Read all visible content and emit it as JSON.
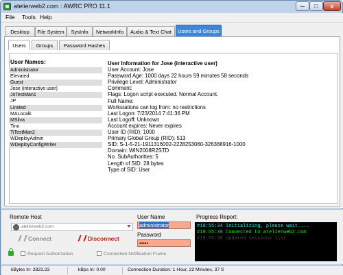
{
  "window": {
    "title": "atelierweb2.com : AWRC PRO 11.1",
    "min": "─",
    "max": "□",
    "close": "x"
  },
  "menu": [
    "File",
    "Tools",
    "Help"
  ],
  "main_tabs": [
    "Desktop",
    "File System",
    "SysInfo",
    "NetworkInfo",
    "Audio & Text Chat",
    "Users and Groups"
  ],
  "active_main_tab": "Users and Groups",
  "sub_tabs": [
    "Users",
    "Groups",
    "Password Hashes"
  ],
  "users": {
    "title": "User Names:",
    "items": [
      "Administrator",
      "Elevated",
      "Guest",
      "Jose (interactive user)",
      "JoTestMan1",
      "JP",
      "Limited",
      "MALocalk",
      "MSilva",
      "Tino",
      "TiTestMan2",
      "WDeployAdmin",
      "WDeployConfigWriter"
    ]
  },
  "info": {
    "title": "User Information for Jose (interactive user)",
    "lines": [
      "User Account: Jose",
      "Password Age: 1000 days 22 hours 59 minutes 58 seconds",
      "Privilege Level: Administrator",
      "Comment:",
      "Flags: Logon script executed. Normal Account.",
      "Full Name:",
      "Workstations can log from: no restrictions",
      "Last Logon: 7/23/2014 7:41:36 PM",
      "Last Logoff: Unknown",
      "Account expires: Never expires",
      "User ID (RID): 1000",
      "Primary Global Group (RID): 513",
      "SID: S-1-5-21-1911316002-2228253060-326368916-1000",
      "Domain: WIN2008R2STD",
      "No. SubAuthorities: 5",
      "Length of SID: 28 bytes",
      "Type of SID: User"
    ]
  },
  "bottom": {
    "remote_host_label": "Remote Host",
    "remote_host_value": "atelierweb2.com",
    "connect_label": "Connect",
    "disconnect_label": "Disconnect",
    "request_auth_label": "Request Authorization",
    "conn_notify_label": "Connection Notification Frame",
    "username_label": "User Name",
    "username_value": "administrator",
    "password_label": "Password",
    "password_value": "•••••",
    "progress_label": "Progress Report:",
    "progress_lines": [
      {
        "text": "#19:55:34 Initializing, please wait....",
        "color": "#3ee0e0"
      },
      {
        "text": "#19:55:38 Connected to atelierweb2.com",
        "color": "#2fe02f"
      },
      {
        "text": "#19:55:38 Updated sessions list",
        "color": "#4a4a4a"
      }
    ]
  },
  "status": {
    "kbytes_in": "kBytes In:  2823.23",
    "kbps_in": "kBps In:  0.00",
    "duration": "Connection Duration:  1 Hour, 22 Minutes, 37 S"
  }
}
